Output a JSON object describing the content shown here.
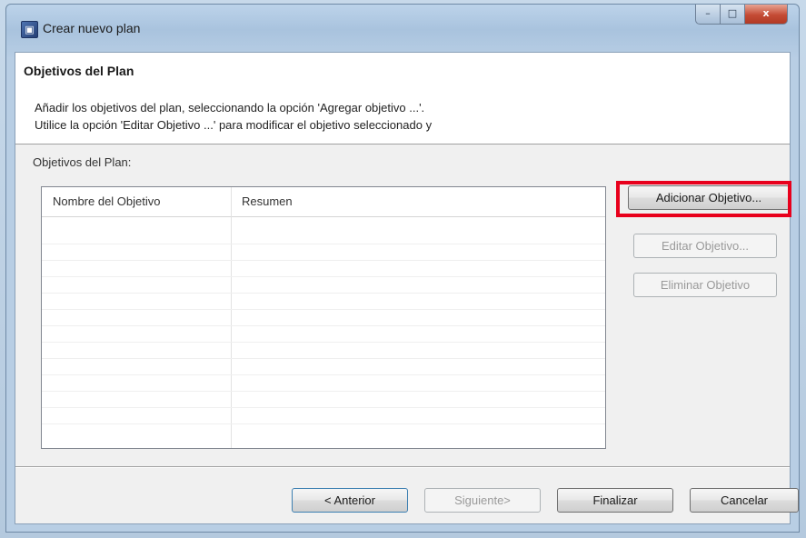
{
  "window": {
    "title": "Crear nuevo plan",
    "icon": "app-icon",
    "caption": {
      "minimize": "–",
      "maximize": "□",
      "close": "x"
    }
  },
  "header": {
    "title": "Objetivos del Plan",
    "description_line1": "Añadir los objetivos del plan, seleccionando la opción 'Agregar objetivo ...'.",
    "description_line2": "Utilice la opción 'Editar Objetivo ...' para modificar el objetivo seleccionado y"
  },
  "objectives": {
    "section_label": "Objetivos del Plan:",
    "columns": [
      "Nombre del Objetivo",
      "Resumen"
    ],
    "rows": []
  },
  "side_buttons": {
    "add": "Adicionar Objetivo...",
    "edit": "Editar Objetivo...",
    "delete": "Eliminar Objetivo"
  },
  "footer_buttons": {
    "back": "< Anterior",
    "next": "Siguiente>",
    "finish": "Finalizar",
    "cancel": "Cancelar"
  },
  "colors": {
    "highlight": "#e8001c"
  }
}
